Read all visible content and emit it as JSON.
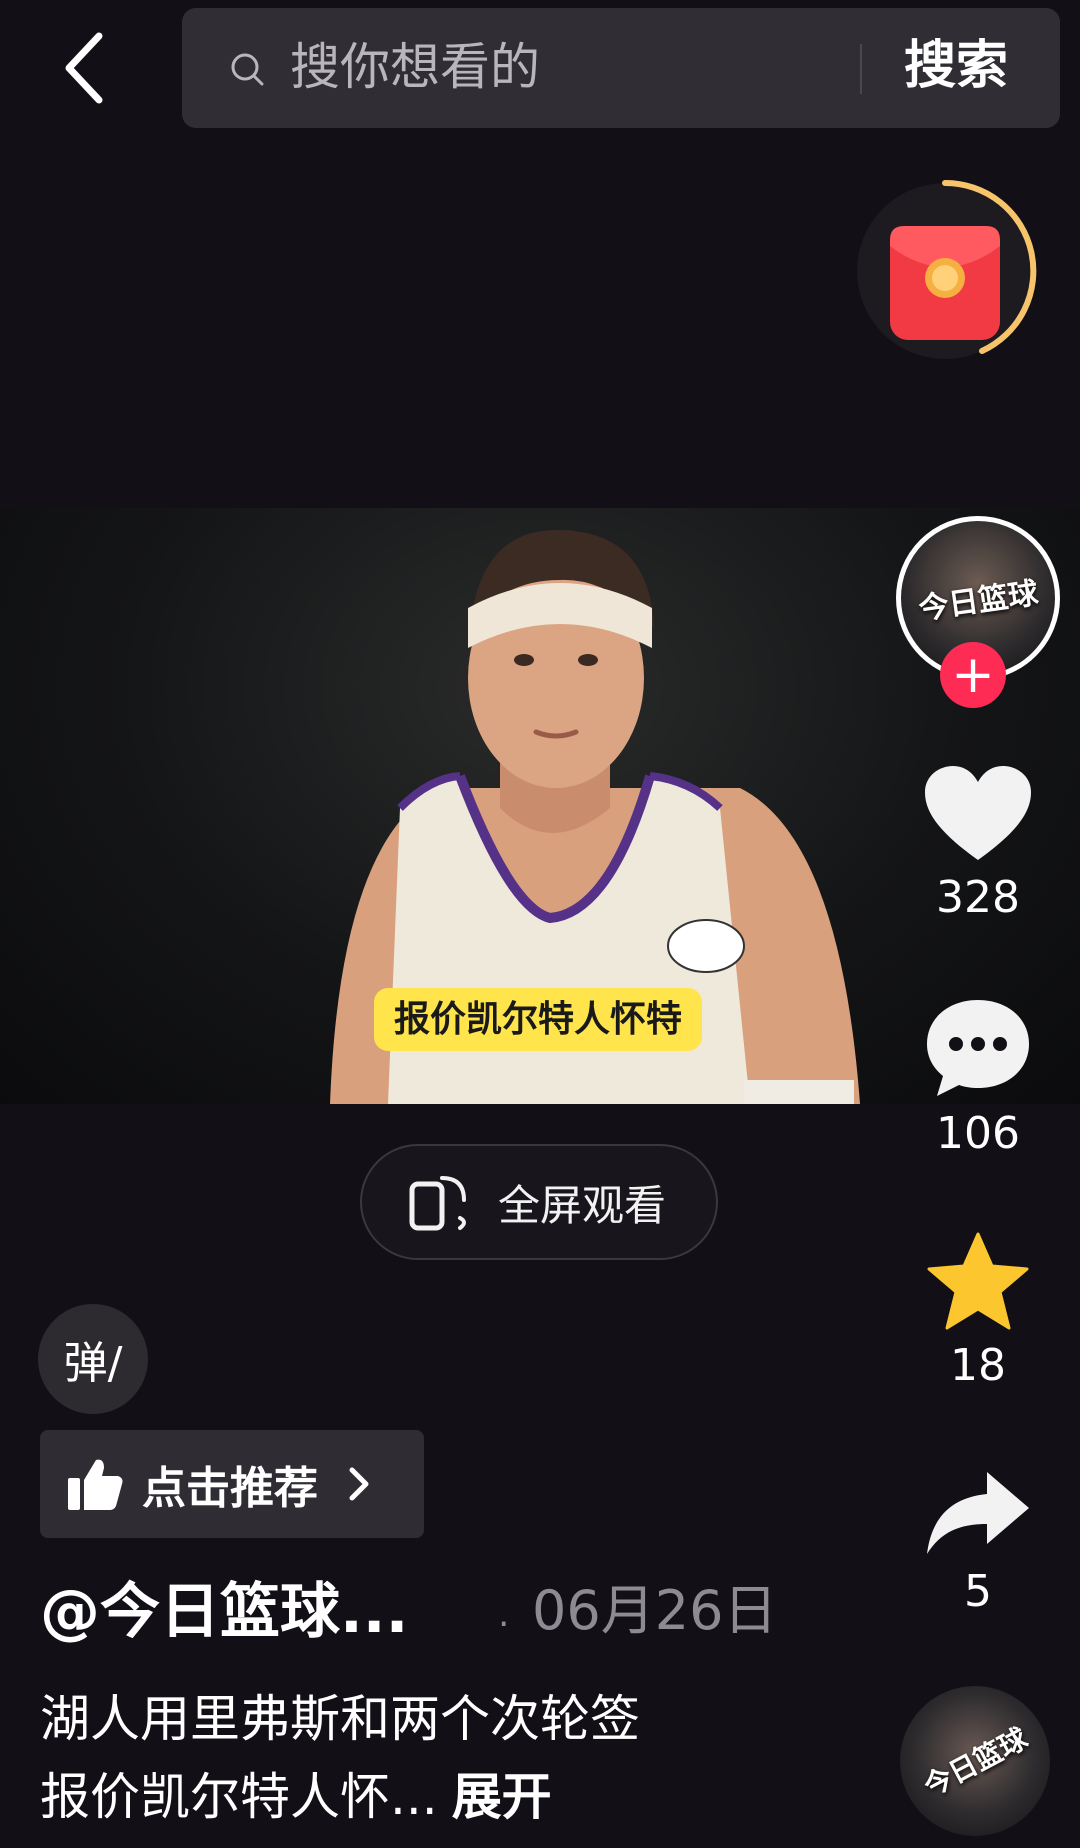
{
  "header": {
    "search_placeholder": "搜你想看的",
    "search_button_label": "搜索"
  },
  "video": {
    "caption": "报价凯尔特人怀特",
    "fullscreen_label": "全屏观看"
  },
  "author_avatar": {
    "text": "今日篮球",
    "follow_symbol": "+"
  },
  "actions": {
    "likes": "328",
    "comments": "106",
    "favorites": "18",
    "shares": "5"
  },
  "danmaku": {
    "label": "弹/"
  },
  "recommend": {
    "label": "点击推荐"
  },
  "post": {
    "author": "@今日篮球...",
    "separator": "·",
    "date": "06月26日",
    "description_line1": "湖人用里弗斯和两个次轮签",
    "description_line2": "报价凯尔特人怀...",
    "expand_label": "展开"
  },
  "music_disc": {
    "text": "今日篮球"
  },
  "colors": {
    "background": "#120f17",
    "accent_red": "#fe2c55",
    "star_gold": "#fcc62f",
    "caption_yellow": "#ffe54b"
  }
}
